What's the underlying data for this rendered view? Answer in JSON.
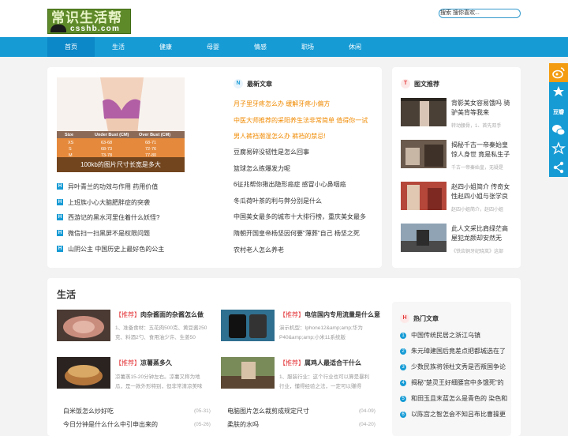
{
  "header": {
    "logo_text": "常识生活帮",
    "logo_domain": "csshb.com",
    "search_value": "搜索 搜你喜欢..."
  },
  "nav": [
    "首页",
    "生活",
    "健康",
    "母婴",
    "情感",
    "职场",
    "休闲"
  ],
  "featured": {
    "caption": "100kb的图片尺寸长宽是多大",
    "table": {
      "headers": [
        "Size",
        "Under Bust (CM)",
        "Over Bust (CM)"
      ],
      "rows": [
        [
          "XS",
          "63-68",
          "68-71"
        ],
        [
          "S",
          "68-73",
          "72-76"
        ],
        [
          "M",
          "73-78",
          "77-80"
        ],
        [
          "L",
          "",
          ""
        ],
        [
          "XL",
          "",
          ""
        ]
      ]
    },
    "list": [
      "异叶青兰的功效与作用 药用价值",
      "上班族小心大脑肥胖症的突袭",
      "西游记的黑水河里住着什么妖怪?",
      "微信扫一扫黑屏不是权限问题",
      "山阴公主 中国历史上最好色的公主"
    ]
  },
  "latest": {
    "badge": "N",
    "title": "最新文章",
    "items": [
      {
        "text": "月子里牙疼怎么办 缓解牙疼小偏方",
        "hot": true
      },
      {
        "text": "中医大师推荐的采阳养生法非常简单 值得你一试",
        "hot": true
      },
      {
        "text": "男人裤裆潮湿怎么办 裤裆的禁忌!",
        "hot": true
      },
      {
        "text": "豆腐易碎没韧性是怎么回事",
        "hot": false
      },
      {
        "text": "篮球怎么练爆发力呢",
        "hot": false
      },
      {
        "text": "6征兆帮你揪出隐形癌症 感冒小心鼻咽癌",
        "hot": false
      },
      {
        "text": "冬瓜荷叶茶的利与弊分别是什么",
        "hot": false
      },
      {
        "text": "中国美女最多的城市十大排行榜，重庆美女最多",
        "hot": false
      },
      {
        "text": "隋朝开国皇帝杨坚因何要\"薄葬\"自己 杨坚之死",
        "hot": false
      },
      {
        "text": "农村老人怎么养老",
        "hot": false
      }
    ]
  },
  "image_posts": {
    "badge": "T",
    "title": "图文推荐",
    "items": [
      {
        "title": "背影美女容易饿吗 骑驴美背等我来",
        "meta": "转动腰骨，1、首先双手"
      },
      {
        "title": "揭秘千古一帝秦始皇惊人身世 竟是私生子",
        "meta": "千古一帝秦始皇，无疑是"
      },
      {
        "title": "赵四小姐简介 传奇女性赵四小姐与张学良",
        "meta": "赵四小姐简介，赵四小姐"
      },
      {
        "title": "此人文采比肩绿茫高屋犯龙颜却安然无",
        "meta": "《铁齿铜牙纪晓岚》这部"
      }
    ]
  },
  "life": {
    "title": "生活",
    "posts": [
      {
        "tag": "【推荐】",
        "title": "肉杂酱面的杂酱怎么做",
        "desc": "1、准备食材：五花肉500克、黄豆酱250克、料酒2勺、食用油少许、生姜50"
      },
      {
        "tag": "【推荐】",
        "title": "电信国内专用流量是什么意",
        "desc": "演示机型：Iphone12&amp;amp;华为P40&amp;amp;小米11系统版"
      },
      {
        "tag": "【推荐】",
        "title": "凉薯蒸多久",
        "desc": "凉薯蒸15-20分钟左右。凉薯又称为地瓜，是一款外形特别，但非常清凉美味"
      },
      {
        "tag": "【推荐】",
        "title": "属鸡人最适合干什么",
        "desc": "1、服装行业：这个行业也可以算是暴利行业，懂得经验之法，一定可以赚得"
      }
    ],
    "links": [
      {
        "text": "白米饭怎么炒好吃",
        "date": "(05-31)"
      },
      {
        "text": "电脑图片怎么裁剪成规定尺寸",
        "date": "(04-09)"
      },
      {
        "text": "今日分钟是什么什么中引申出来的",
        "date": "(05-26)"
      },
      {
        "text": "柔肤的水吗",
        "date": "(04-20)"
      }
    ]
  },
  "hot": {
    "badge": "H",
    "title": "热门文章",
    "items": [
      "中国传统民居之浙江乌镇",
      "朱元璋建国后竟差点把都城选在了",
      "少数民族将领杜文秀是否叛国争论",
      "揭秘\"楚灵王好细腰宫中多饿死\"的",
      "和田玉且末蓝怎么是青色的 染色和",
      "以陈宫之智怎会不知吕布比曹操更"
    ]
  },
  "sidebar": {
    "weibo": "微博",
    "qzone": "QQ空间",
    "douban": "豆瓣",
    "wechat": "微信",
    "favorite": "收藏",
    "share": "分享",
    "douban_label": "豆瓣"
  },
  "colors": {
    "primary": "#169bd5",
    "sidebar_orange": "#f39c12",
    "hot_text": "#f08a00",
    "tag_red": "#e4393c"
  }
}
